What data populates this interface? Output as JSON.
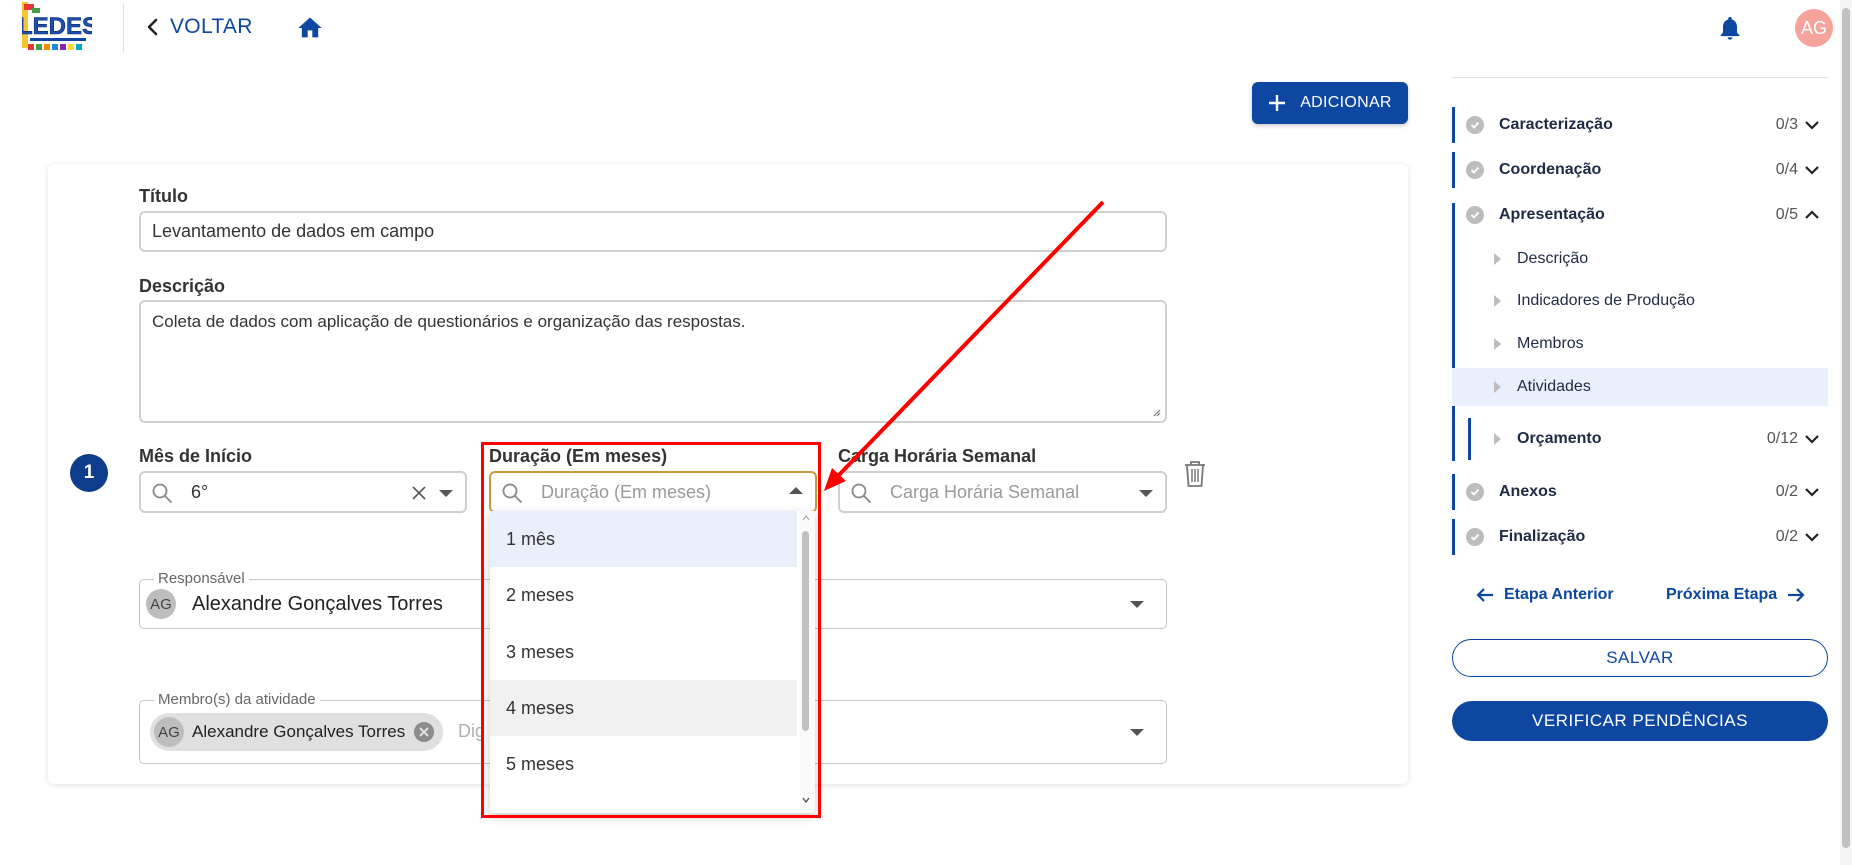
{
  "header": {
    "logo_text": "LEDES",
    "back_label": "VOLTAR",
    "avatar_initials": "AG",
    "icons": [
      "chevron-left-icon",
      "home-icon",
      "bell-icon"
    ]
  },
  "main": {
    "add_button_label": "ADICIONAR",
    "activity": {
      "index": "1",
      "title_label": "Título",
      "title_value": "Levantamento de dados em campo",
      "description_label": "Descrição",
      "description_value": "Coleta de dados com aplicação de questionários e organização das respostas.",
      "start_month_label": "Mês de Início",
      "start_month_value": "6°",
      "duration_label": "Duração (Em meses)",
      "duration_placeholder": "Duração (Em meses)",
      "weekly_hours_label": "Carga Horária Semanal",
      "weekly_hours_placeholder": "Carga Horária Semanal",
      "responsible_label": "Responsável",
      "responsible_initials": "AG",
      "responsible_name": "Alexandre Gonçalves Torres",
      "members_label": "Membro(s) da atividade",
      "member_chip_initials": "AG",
      "member_chip_name": "Alexandre Gonçalves Torres",
      "members_input_placeholder": "Dig"
    },
    "duration_options": [
      {
        "label": "1 mês",
        "state": "selected"
      },
      {
        "label": "2 meses",
        "state": "normal"
      },
      {
        "label": "3 meses",
        "state": "normal"
      },
      {
        "label": "4 meses",
        "state": "hover"
      },
      {
        "label": "5 meses",
        "state": "normal"
      }
    ]
  },
  "sidebar": {
    "sections": [
      {
        "label": "Caracterização",
        "count": "0/3",
        "expanded": false
      },
      {
        "label": "Coordenação",
        "count": "0/4",
        "expanded": false
      },
      {
        "label": "Apresentação",
        "count": "0/5",
        "expanded": true
      },
      {
        "label": "Anexos",
        "count": "0/2",
        "expanded": false
      },
      {
        "label": "Finalização",
        "count": "0/2",
        "expanded": false
      }
    ],
    "subitems": [
      {
        "label": "Descrição",
        "active": false
      },
      {
        "label": "Indicadores de Produção",
        "active": false
      },
      {
        "label": "Membros",
        "active": false
      },
      {
        "label": "Atividades",
        "active": true
      }
    ],
    "budget": {
      "label": "Orçamento",
      "count": "0/12"
    },
    "prev_step_label": "Etapa Anterior",
    "next_step_label": "Próxima Etapa",
    "save_label": "SALVAR",
    "verify_label": "VERIFICAR PENDÊNCIAS"
  },
  "colors": {
    "primary": "#0d47a1",
    "annotation": "#ff0000",
    "avatar_top": "#f6a39c",
    "option_selected_bg": "#e9f0fb"
  }
}
